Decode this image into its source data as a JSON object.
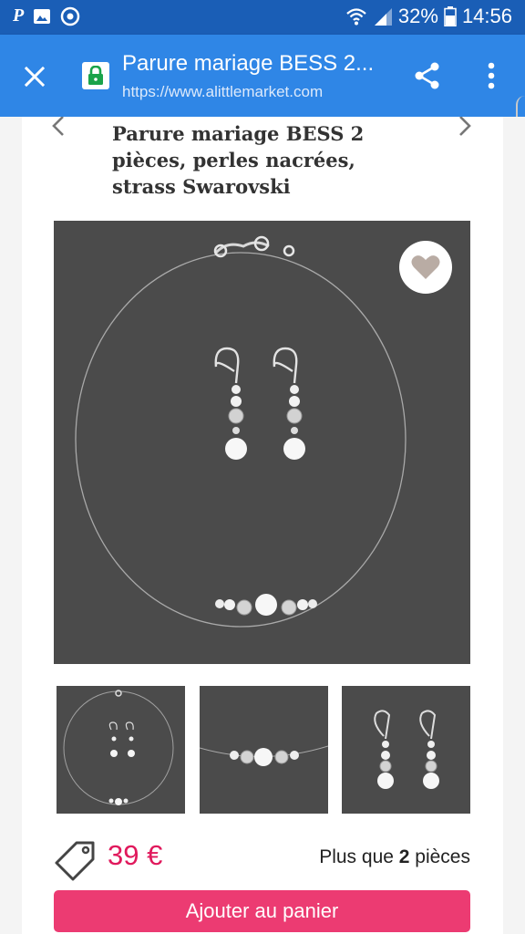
{
  "status_bar": {
    "left_icon_label": "P",
    "battery_percent": "32%",
    "time": "14:56"
  },
  "toolbar": {
    "title": "Parure mariage BESS 2...",
    "url": "https://www.alittlemarket.com"
  },
  "product": {
    "title_lines": [
      "Parure mariage BESS 2",
      "pièces, perles nacrées,",
      "strass Swarovski"
    ],
    "price": "39 €",
    "stock_prefix": "Plus que ",
    "stock_count": "2",
    "stock_suffix": " pièces",
    "add_to_cart": "Ajouter au panier"
  },
  "colors": {
    "status_bar": "#1a5eb6",
    "toolbar": "#2f86e6",
    "price": "#e0195c",
    "button": "#ec3b72",
    "image_bg": "#4b4b4b",
    "favorite_heart": "#b9aca4"
  },
  "icons": {
    "close": "close-icon",
    "lock": "lock-icon",
    "share": "share-icon",
    "menu": "more-vert-icon",
    "prev": "chevron-left-icon",
    "next": "chevron-right-icon",
    "favorite": "heart-icon",
    "price_tag": "price-tag-icon"
  }
}
